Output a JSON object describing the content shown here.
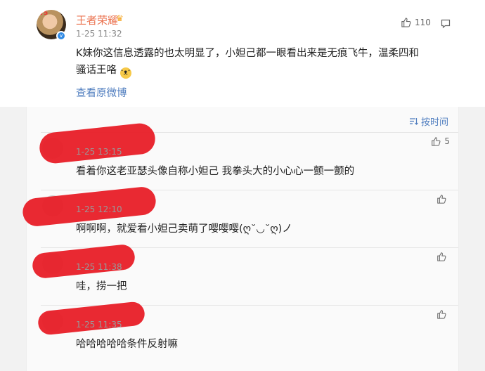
{
  "post": {
    "username": "王者荣耀",
    "crown_icon": "crown-icon",
    "time": "1-25 11:32",
    "likes": "110",
    "text_main": "K妹你这信息透露的也太明显了，小妲己都一眼看出来是无痕飞牛，温柔四和骚话王咯",
    "view_original": "查看原微博"
  },
  "sort": {
    "label": "按时间",
    "icon": "sort-icon"
  },
  "comments": [
    {
      "time": "1-25 13:15",
      "likes": "5",
      "text": "看着你这老亚瑟头像自称小妲己 我拳头大的小心心一颤一颤的"
    },
    {
      "time": "1-25 12:10",
      "likes": "",
      "text": "啊啊啊，就爱看小妲己卖萌了嘤嘤嘤(ღ˘◡˘ღ)ノ"
    },
    {
      "time": "1-25 11:38",
      "likes": "",
      "text": "哇，捞一把"
    },
    {
      "time": "1-25 11:35",
      "likes": "",
      "text": "哈哈哈哈哈条件反射嘛"
    }
  ],
  "colors": {
    "username": "#eb7350",
    "link": "#4f7dbf",
    "redaction": "#e8202a"
  }
}
